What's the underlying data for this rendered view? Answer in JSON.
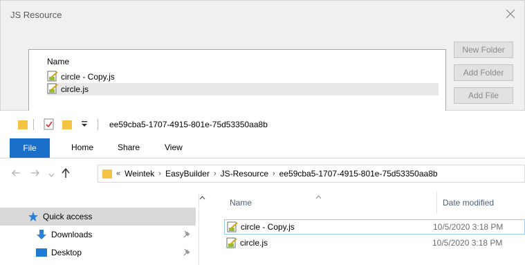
{
  "dialog": {
    "title": "JS Resource",
    "list_header": "Name",
    "files": [
      {
        "name": "circle - Copy.js",
        "icon": "js-file-icon",
        "selected": false
      },
      {
        "name": "circle.js",
        "icon": "js-file-icon",
        "selected": true
      }
    ],
    "buttons": {
      "new_folder": "New Folder",
      "add_folder": "Add Folder",
      "add_file": "Add File"
    }
  },
  "explorer": {
    "title": "ee59cba5-1707-4915-801e-75d53350aa8b",
    "ribbon_tabs": [
      "File",
      "Home",
      "Share",
      "View"
    ],
    "breadcrumb": [
      "Weintek",
      "EasyBuilder",
      "JS-Resource",
      "ee59cba5-1707-4915-801e-75d53350aa8b"
    ],
    "nav_items": [
      {
        "label": "Quick access",
        "icon": "star-icon",
        "pinned": false
      },
      {
        "label": "Downloads",
        "icon": "download-arrow-icon",
        "pinned": true
      },
      {
        "label": "Desktop",
        "icon": "desktop-icon",
        "pinned": true
      }
    ],
    "columns": {
      "name": "Name",
      "date_modified": "Date modified"
    },
    "files": [
      {
        "name": "circle - Copy.js",
        "date": "10/5/2020 3:18 PM"
      },
      {
        "name": "circle.js",
        "date": "10/5/2020 3:18 PM"
      }
    ]
  },
  "colors": {
    "accent": "#1a6fc9",
    "folder": "#f5c342",
    "selection": "#99c9ef"
  }
}
